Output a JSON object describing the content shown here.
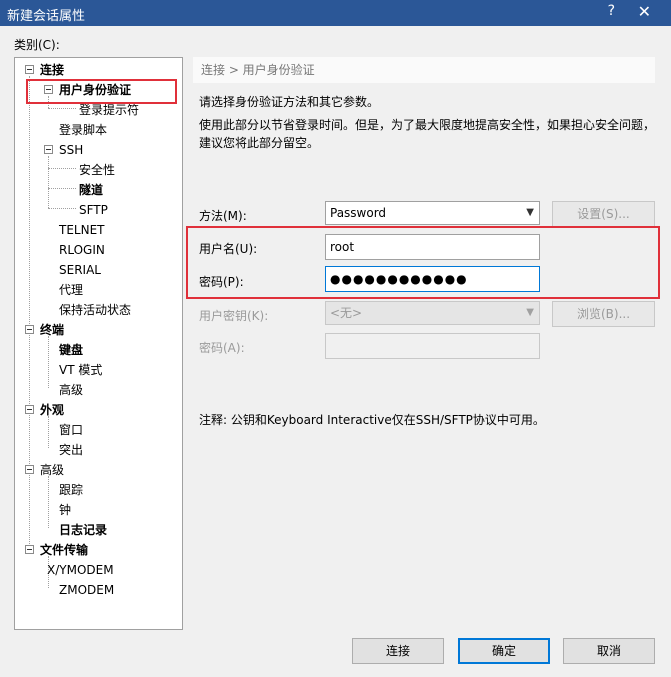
{
  "window": {
    "title": "新建会话属性",
    "help_glyph": "?",
    "close_glyph": "✕"
  },
  "category_label": "类别(C):",
  "tree": {
    "items": [
      {
        "label": "连接"
      },
      {
        "label": "用户身份验证"
      },
      {
        "label": "登录提示符"
      },
      {
        "label": "登录脚本"
      },
      {
        "label": "SSH"
      },
      {
        "label": "安全性"
      },
      {
        "label": "隧道"
      },
      {
        "label": "SFTP"
      },
      {
        "label": "TELNET"
      },
      {
        "label": "RLOGIN"
      },
      {
        "label": "SERIAL"
      },
      {
        "label": "代理"
      },
      {
        "label": "保持活动状态"
      },
      {
        "label": "终端"
      },
      {
        "label": "键盘"
      },
      {
        "label": "VT 模式"
      },
      {
        "label": "高级"
      },
      {
        "label": "外观"
      },
      {
        "label": "窗口"
      },
      {
        "label": "突出"
      },
      {
        "label": "高级"
      },
      {
        "label": "跟踪"
      },
      {
        "label": "钟"
      },
      {
        "label": "日志记录"
      },
      {
        "label": "文件传输"
      },
      {
        "label": "X/YMODEM"
      },
      {
        "label": "ZMODEM"
      }
    ]
  },
  "breadcrumb": "连接 > 用户身份验证",
  "intro": "请选择身份验证方法和其它参数。",
  "desc_line1": "使用此部分以节省登录时间。但是，为了最大限度地提高安全性，如果担心安全问题，",
  "desc_line2": "建议您将此部分留空。",
  "form": {
    "method_label": "方法(M):",
    "method_value": "Password",
    "settings_button": "设置(S)...",
    "username_label": "用户名(U):",
    "username_value": "root",
    "password_label": "密码(P):",
    "password_value": "●●●●●●●●●●●●",
    "userkey_label": "用户密钥(K):",
    "userkey_value": "<无>",
    "browse_button": "浏览(B)...",
    "passphrase_label": "密码(A):",
    "passphrase_value": ""
  },
  "note": "注释: 公钥和Keyboard Interactive仅在SSH/SFTP协议中可用。",
  "buttons": {
    "connect": "连接",
    "ok": "确定",
    "cancel": "取消"
  },
  "colors": {
    "titlebar": "#2b5797",
    "highlight": "#e0303a",
    "focus": "#0078d7"
  }
}
